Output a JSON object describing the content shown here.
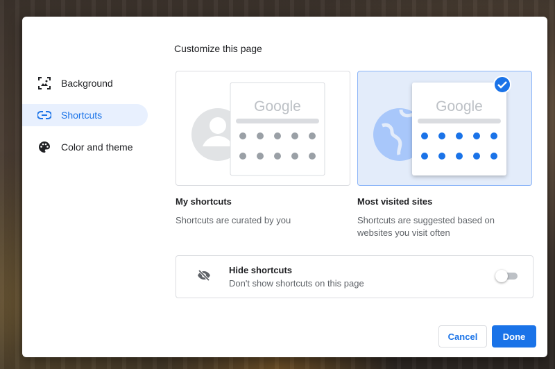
{
  "dialog": {
    "title": "Customize this page"
  },
  "sidebar": {
    "items": [
      {
        "label": "Background",
        "icon": "image-icon",
        "active": false
      },
      {
        "label": "Shortcuts",
        "icon": "link-icon",
        "active": true
      },
      {
        "label": "Color and theme",
        "icon": "palette-icon",
        "active": false
      }
    ]
  },
  "options": [
    {
      "title": "My shortcuts",
      "description": "Shortcuts are curated by you",
      "selected": false,
      "preview_logo": "Google"
    },
    {
      "title": "Most visited sites",
      "description": "Shortcuts are suggested based on websites you visit often",
      "selected": true,
      "preview_logo": "Google"
    }
  ],
  "hide_shortcuts": {
    "title": "Hide shortcuts",
    "description": "Don't show shortcuts on this page",
    "enabled": false,
    "icon": "eye-off-icon"
  },
  "buttons": {
    "cancel": "Cancel",
    "done": "Done"
  },
  "colors": {
    "accent": "#1a73e8",
    "selected_bg": "#e3ecfa",
    "active_nav_bg": "#e8f0fe"
  }
}
